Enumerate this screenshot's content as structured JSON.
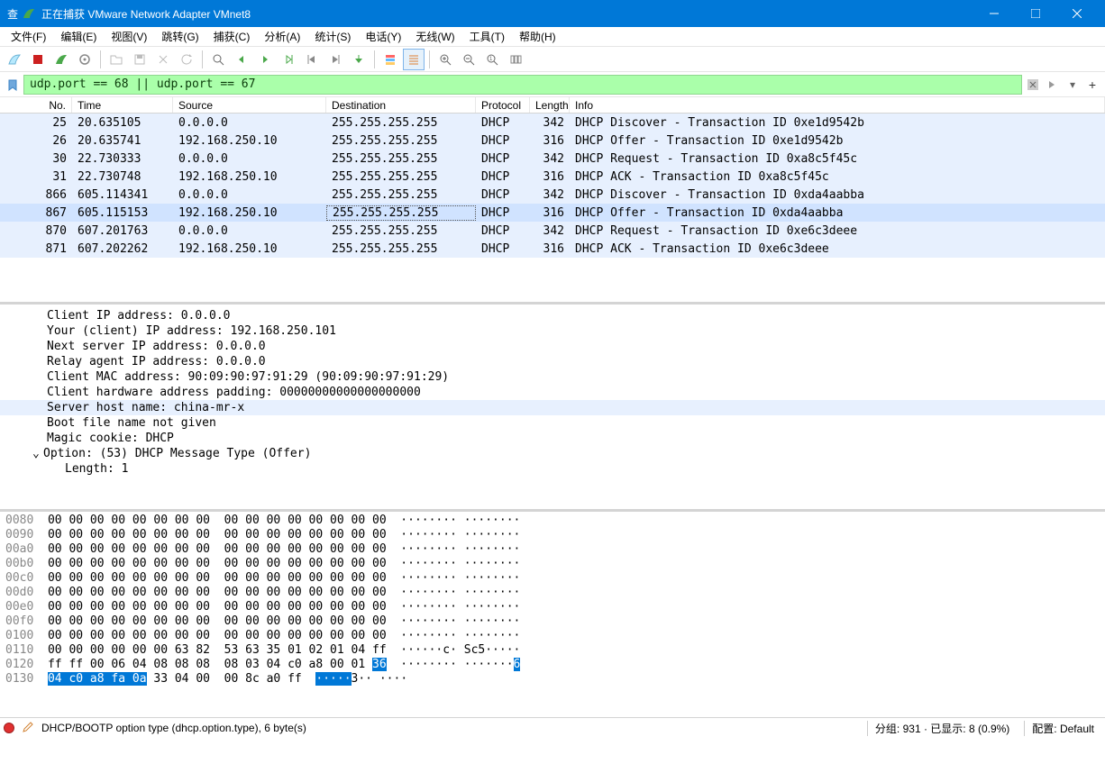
{
  "window": {
    "title": "正在捕获 VMware Network Adapter VMnet8",
    "left_label": "查"
  },
  "menu": [
    "文件(F)",
    "编辑(E)",
    "视图(V)",
    "跳转(G)",
    "捕获(C)",
    "分析(A)",
    "统计(S)",
    "电话(Y)",
    "无线(W)",
    "工具(T)",
    "帮助(H)"
  ],
  "filter": {
    "value": "udp.port == 68 || udp.port == 67"
  },
  "columns": {
    "no": "No.",
    "time": "Time",
    "src": "Source",
    "dst": "Destination",
    "proto": "Protocol",
    "len": "Length",
    "info": "Info"
  },
  "packets": [
    {
      "no": "25",
      "time": "20.635105",
      "src": "0.0.0.0",
      "dst": "255.255.255.255",
      "proto": "DHCP",
      "len": "342",
      "info": "DHCP Discover - Transaction ID 0xe1d9542b"
    },
    {
      "no": "26",
      "time": "20.635741",
      "src": "192.168.250.10",
      "dst": "255.255.255.255",
      "proto": "DHCP",
      "len": "316",
      "info": "DHCP Offer    - Transaction ID 0xe1d9542b"
    },
    {
      "no": "30",
      "time": "22.730333",
      "src": "0.0.0.0",
      "dst": "255.255.255.255",
      "proto": "DHCP",
      "len": "342",
      "info": "DHCP Request  - Transaction ID 0xa8c5f45c"
    },
    {
      "no": "31",
      "time": "22.730748",
      "src": "192.168.250.10",
      "dst": "255.255.255.255",
      "proto": "DHCP",
      "len": "316",
      "info": "DHCP ACK      - Transaction ID 0xa8c5f45c"
    },
    {
      "no": "866",
      "time": "605.114341",
      "src": "0.0.0.0",
      "dst": "255.255.255.255",
      "proto": "DHCP",
      "len": "342",
      "info": "DHCP Discover - Transaction ID 0xda4aabba"
    },
    {
      "no": "867",
      "time": "605.115153",
      "src": "192.168.250.10",
      "dst": "255.255.255.255",
      "proto": "DHCP",
      "len": "316",
      "info": "DHCP Offer    - Transaction ID 0xda4aabba",
      "selected": true
    },
    {
      "no": "870",
      "time": "607.201763",
      "src": "0.0.0.0",
      "dst": "255.255.255.255",
      "proto": "DHCP",
      "len": "342",
      "info": "DHCP Request  - Transaction ID 0xe6c3deee"
    },
    {
      "no": "871",
      "time": "607.202262",
      "src": "192.168.250.10",
      "dst": "255.255.255.255",
      "proto": "DHCP",
      "len": "316",
      "info": "DHCP ACK      - Transaction ID 0xe6c3deee"
    }
  ],
  "details": [
    {
      "text": "Client IP address: 0.0.0.0"
    },
    {
      "text": "Your (client) IP address: 192.168.250.101"
    },
    {
      "text": "Next server IP address: 0.0.0.0"
    },
    {
      "text": "Relay agent IP address: 0.0.0.0"
    },
    {
      "text": "Client MAC address: 90:09:90:97:91:29 (90:09:90:97:91:29)"
    },
    {
      "text": "Client hardware address padding: 00000000000000000000"
    },
    {
      "text": "Server host name: china-mr-x",
      "sel": true
    },
    {
      "text": "Boot file name not given"
    },
    {
      "text": "Magic cookie: DHCP"
    },
    {
      "text": "Option: (53) DHCP Message Type (Offer)",
      "tree": true,
      "caret": "⌄"
    },
    {
      "text": "Length: 1",
      "sub": true
    }
  ],
  "hex": [
    {
      "off": "0080",
      "bytes": "00 00 00 00 00 00 00 00  00 00 00 00 00 00 00 00",
      "ascii": "········ ········"
    },
    {
      "off": "0090",
      "bytes": "00 00 00 00 00 00 00 00  00 00 00 00 00 00 00 00",
      "ascii": "········ ········"
    },
    {
      "off": "00a0",
      "bytes": "00 00 00 00 00 00 00 00  00 00 00 00 00 00 00 00",
      "ascii": "········ ········"
    },
    {
      "off": "00b0",
      "bytes": "00 00 00 00 00 00 00 00  00 00 00 00 00 00 00 00",
      "ascii": "········ ········"
    },
    {
      "off": "00c0",
      "bytes": "00 00 00 00 00 00 00 00  00 00 00 00 00 00 00 00",
      "ascii": "········ ········"
    },
    {
      "off": "00d0",
      "bytes": "00 00 00 00 00 00 00 00  00 00 00 00 00 00 00 00",
      "ascii": "········ ········"
    },
    {
      "off": "00e0",
      "bytes": "00 00 00 00 00 00 00 00  00 00 00 00 00 00 00 00",
      "ascii": "········ ········"
    },
    {
      "off": "00f0",
      "bytes": "00 00 00 00 00 00 00 00  00 00 00 00 00 00 00 00",
      "ascii": "········ ········"
    },
    {
      "off": "0100",
      "bytes": "00 00 00 00 00 00 00 00  00 00 00 00 00 00 00 00",
      "ascii": "········ ········"
    },
    {
      "off": "0110",
      "bytes": "00 00 00 00 00 00 63 82  53 63 35 01 02 01 04 ff",
      "ascii": "······c· Sc5·····"
    },
    {
      "off": "0120",
      "bytes": "ff ff 00 06 04 08 08 08  08 03 04 c0 a8 00 01 ",
      "hl": "36",
      "ascii": "········ ·······",
      "asciiHl": "6"
    },
    {
      "off": "0130",
      "bytesHl": "04 c0 a8 fa 0a",
      "bytes": " 33 04 00  00 8c a0 ff",
      "ascii": "",
      "asciiHl": "·····",
      "asciiTail": "3·· ····"
    }
  ],
  "status": {
    "text": "DHCP/BOOTP option type (dhcp.option.type), 6 byte(s)",
    "pkts": "分组: 931 · 已显示: 8 (0.9%)",
    "profile": "配置: Default"
  },
  "icons": {
    "shark": "#4aa84a",
    "stop": "#cc0000",
    "restart": "#4aa84a"
  }
}
